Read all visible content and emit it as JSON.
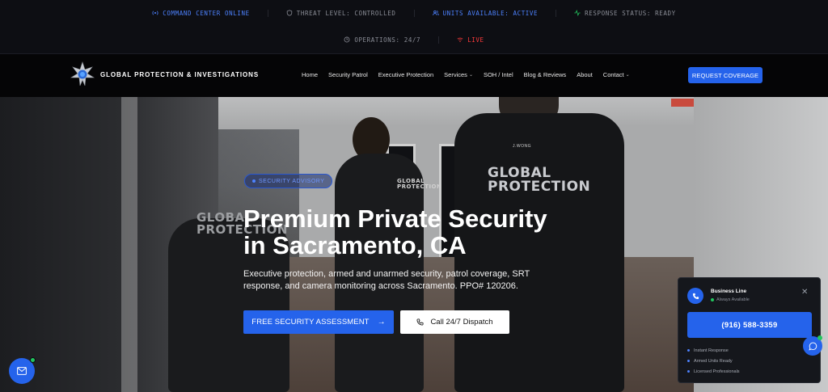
{
  "status_bar": {
    "items": [
      {
        "label": "COMMAND CENTER ONLINE",
        "icon": "radio-icon",
        "color": "#4d82ff"
      },
      {
        "label": "THREAT LEVEL: CONTROLLED",
        "icon": "shield-icon",
        "color": "#8a8d96"
      },
      {
        "label": "UNITS AVAILABLE: ACTIVE",
        "icon": "users-icon",
        "color": "#4d82ff"
      },
      {
        "label": "RESPONSE STATUS: READY",
        "icon": "activity-icon",
        "color": "#8a8d96"
      }
    ],
    "row2": [
      {
        "label": "OPERATIONS: 24/7",
        "icon": "clock-icon",
        "color": "#8a8d96"
      },
      {
        "label": "LIVE",
        "icon": "wifi-icon",
        "color": "#ff3b3b"
      }
    ]
  },
  "nav": {
    "brand": "GLOBAL PROTECTION & INVESTIGATIONS",
    "menu": [
      "Home",
      "Security Patrol",
      "Executive Protection",
      "Services",
      "SOH / Intel",
      "Blog & Reviews",
      "About",
      "Contact"
    ],
    "cta": "REQUEST COVERAGE"
  },
  "hero": {
    "badge": "SECURITY ADVISORY",
    "title_line1": "Premium Private Security",
    "title_line2": "in Sacramento, CA",
    "subtitle": "Executive protection, armed and unarmed security, patrol coverage, SRT response, and camera monitoring across Sacramento. PPO# 120206.",
    "primary_button": "FREE SECURITY ASSESSMENT",
    "secondary_button": "Call 24/7 Dispatch",
    "vest_text_1": "GLOBAL PROTECTION",
    "vest_text_2": "GLOBAL PROTECTION",
    "vest_text_3": "GLOBAL PROTECTION",
    "vest_name": "J.WONG"
  },
  "widget": {
    "title": "Business Line",
    "availability": "Always Available",
    "phone": "(916) 588-3359",
    "features": [
      "Instant Response",
      "Armed Units Ready",
      "Licensed Professionals"
    ]
  },
  "colors": {
    "accent": "#2563eb",
    "live": "#ff3b3b",
    "online": "#22c55e"
  }
}
